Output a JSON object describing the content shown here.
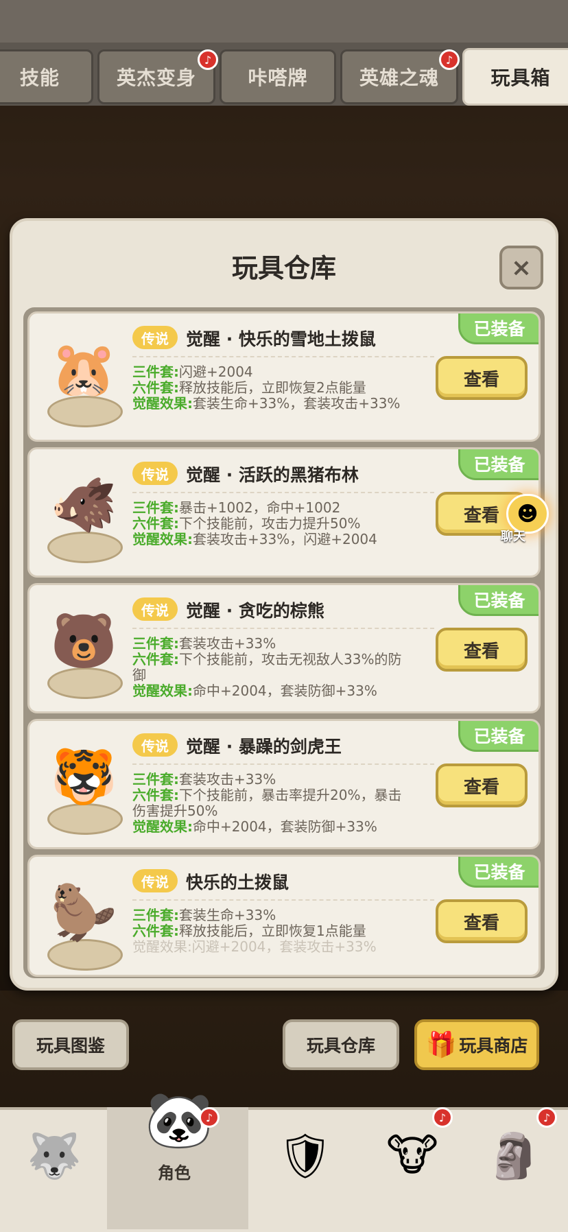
{
  "tabs": [
    {
      "label": "技能",
      "active": false,
      "bell": false
    },
    {
      "label": "英杰变身",
      "active": false,
      "bell": true
    },
    {
      "label": "咔嗒牌",
      "active": false,
      "bell": false
    },
    {
      "label": "英雄之魂",
      "active": false,
      "bell": true
    },
    {
      "label": "玩具箱",
      "active": true,
      "bell": false
    }
  ],
  "modal": {
    "title": "玩具仓库",
    "close_label": "×",
    "equipped_label": "已装备",
    "rarity_label": "传说",
    "view_label": "查看"
  },
  "toys": [
    {
      "name": "觉醒 · 快乐的雪地土拨鼠",
      "icon": "snow-groundhog-icon",
      "lines": [
        {
          "key": "三件套:",
          "text": "闪避+2004"
        },
        {
          "key": "六件套:",
          "text": "释放技能后，立即恢复2点能量"
        },
        {
          "key": "觉醒效果:",
          "text": "套装生命+33%，套装攻击+33%"
        }
      ]
    },
    {
      "name": "觉醒 · 活跃的黑猪布林",
      "icon": "black-boar-icon",
      "lines": [
        {
          "key": "三件套:",
          "text": "暴击+1002，命中+1002"
        },
        {
          "key": "六件套:",
          "text": "下个技能前，攻击力提升50%"
        },
        {
          "key": "觉醒效果:",
          "text": "套装攻击+33%，闪避+2004"
        }
      ]
    },
    {
      "name": "觉醒 · 贪吃的棕熊",
      "icon": "brown-bear-icon",
      "lines": [
        {
          "key": "三件套:",
          "text": "套装攻击+33%"
        },
        {
          "key": "六件套:",
          "text": "下个技能前，攻击无视敌人33%的防御"
        },
        {
          "key": "觉醒效果:",
          "text": "命中+2004，套装防御+33%"
        }
      ]
    },
    {
      "name": "觉醒 · 暴躁的剑虎王",
      "icon": "sabertooth-king-icon",
      "lines": [
        {
          "key": "三件套:",
          "text": "套装攻击+33%"
        },
        {
          "key": "六件套:",
          "text": "下个技能前，暴击率提升20%，暴击伤害提升50%"
        },
        {
          "key": "觉醒效果:",
          "text": "命中+2004，套装防御+33%"
        }
      ]
    },
    {
      "name": "快乐的土拨鼠",
      "icon": "groundhog-icon",
      "lines": [
        {
          "key": "三件套:",
          "text": "套装生命+33%"
        },
        {
          "key": "六件套:",
          "text": "释放技能后，立即恢复1点能量"
        },
        {
          "key": "觉醒效果:",
          "text": "闪避+2004，套装攻击+33%"
        }
      ]
    }
  ],
  "chat": {
    "label": "聊天"
  },
  "actions": {
    "catalog": "玩具图鉴",
    "warehouse": "玩具仓库",
    "shop": "玩具商店"
  },
  "bottom_nav": {
    "active_label": "角色"
  }
}
